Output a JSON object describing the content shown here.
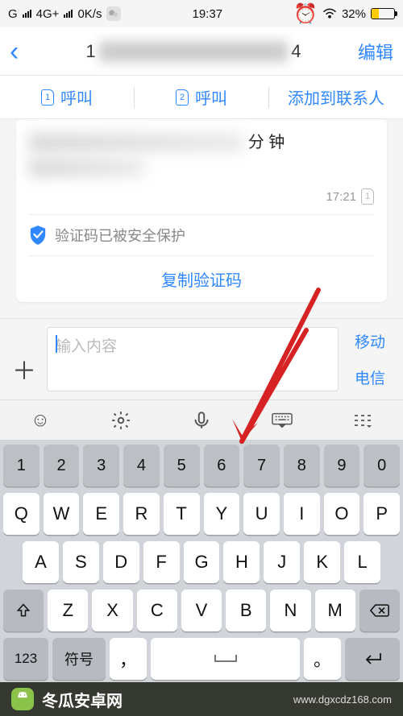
{
  "status": {
    "carrier": "G",
    "net": "4G+",
    "speed": "0K/s",
    "time": "19:37",
    "battery_pct": "32%"
  },
  "nav": {
    "title_prefix": "1",
    "title_suffix": "4",
    "edit": "编辑"
  },
  "tabs": {
    "call1": "呼叫",
    "call2": "呼叫",
    "add_contact": "添加到联系人",
    "sim1": "1",
    "sim2": "2"
  },
  "card": {
    "tail_text": "钟",
    "time": "17:21",
    "sim": "1",
    "protect": "验证码已被安全保护",
    "copy": "复制验证码"
  },
  "input": {
    "placeholder": "输入内容",
    "side1": "移动",
    "side2": "电信"
  },
  "keyboard": {
    "nums": [
      "1",
      "2",
      "3",
      "4",
      "5",
      "6",
      "7",
      "8",
      "9",
      "0"
    ],
    "r1": [
      "Q",
      "W",
      "E",
      "R",
      "T",
      "Y",
      "U",
      "I",
      "O",
      "P"
    ],
    "r2": [
      "A",
      "S",
      "D",
      "F",
      "G",
      "H",
      "J",
      "K",
      "L"
    ],
    "r3": [
      "Z",
      "X",
      "C",
      "V",
      "B",
      "N",
      "M"
    ],
    "num123": "123",
    "sym": "符号",
    "comma": "，",
    "period": "。"
  },
  "footer": {
    "brand": "冬瓜安卓网",
    "host": "www.dgxcdz168.com"
  }
}
